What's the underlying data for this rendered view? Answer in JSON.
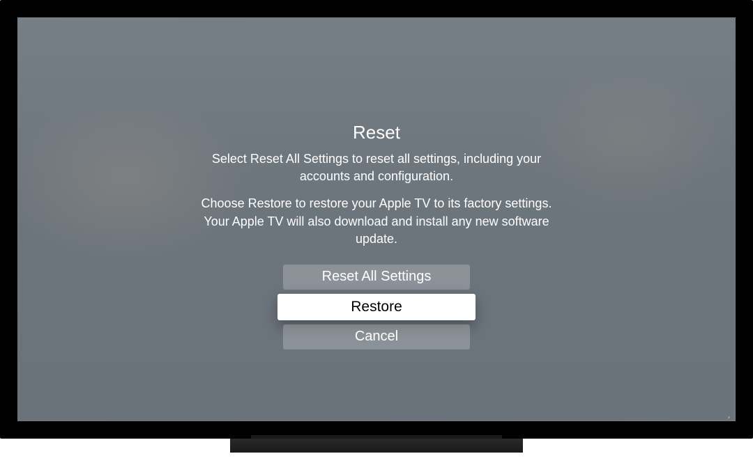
{
  "dialog": {
    "title": "Reset",
    "description_line1": "Select Reset All Settings to reset all settings, including your accounts and configuration.",
    "description_line2": "Choose Restore to restore your Apple TV to its factory settings. Your Apple TV will also download and install any new software update.",
    "buttons": {
      "reset_all": "Reset All Settings",
      "restore": "Restore",
      "cancel": "Cancel"
    }
  }
}
